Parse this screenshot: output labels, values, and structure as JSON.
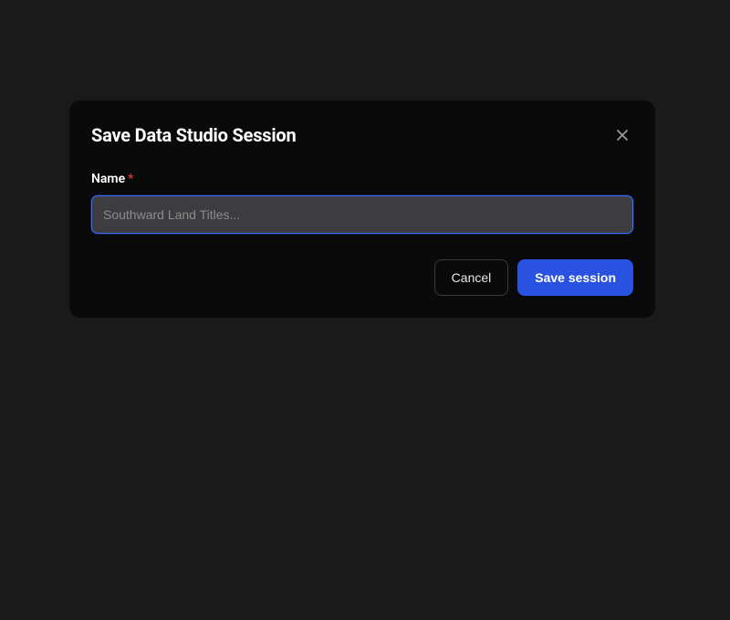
{
  "modal": {
    "title": "Save Data Studio Session",
    "field": {
      "label": "Name",
      "required_marker": "*",
      "placeholder": "Southward Land Titles...",
      "value": ""
    },
    "actions": {
      "cancel_label": "Cancel",
      "save_label": "Save session"
    }
  },
  "colors": {
    "accent": "#2a52e0",
    "focus_border": "#3b6bff",
    "background": "#1a1a1a",
    "modal_bg": "#0a0a0a",
    "input_bg": "#3d3d3f",
    "danger": "#d93838"
  }
}
